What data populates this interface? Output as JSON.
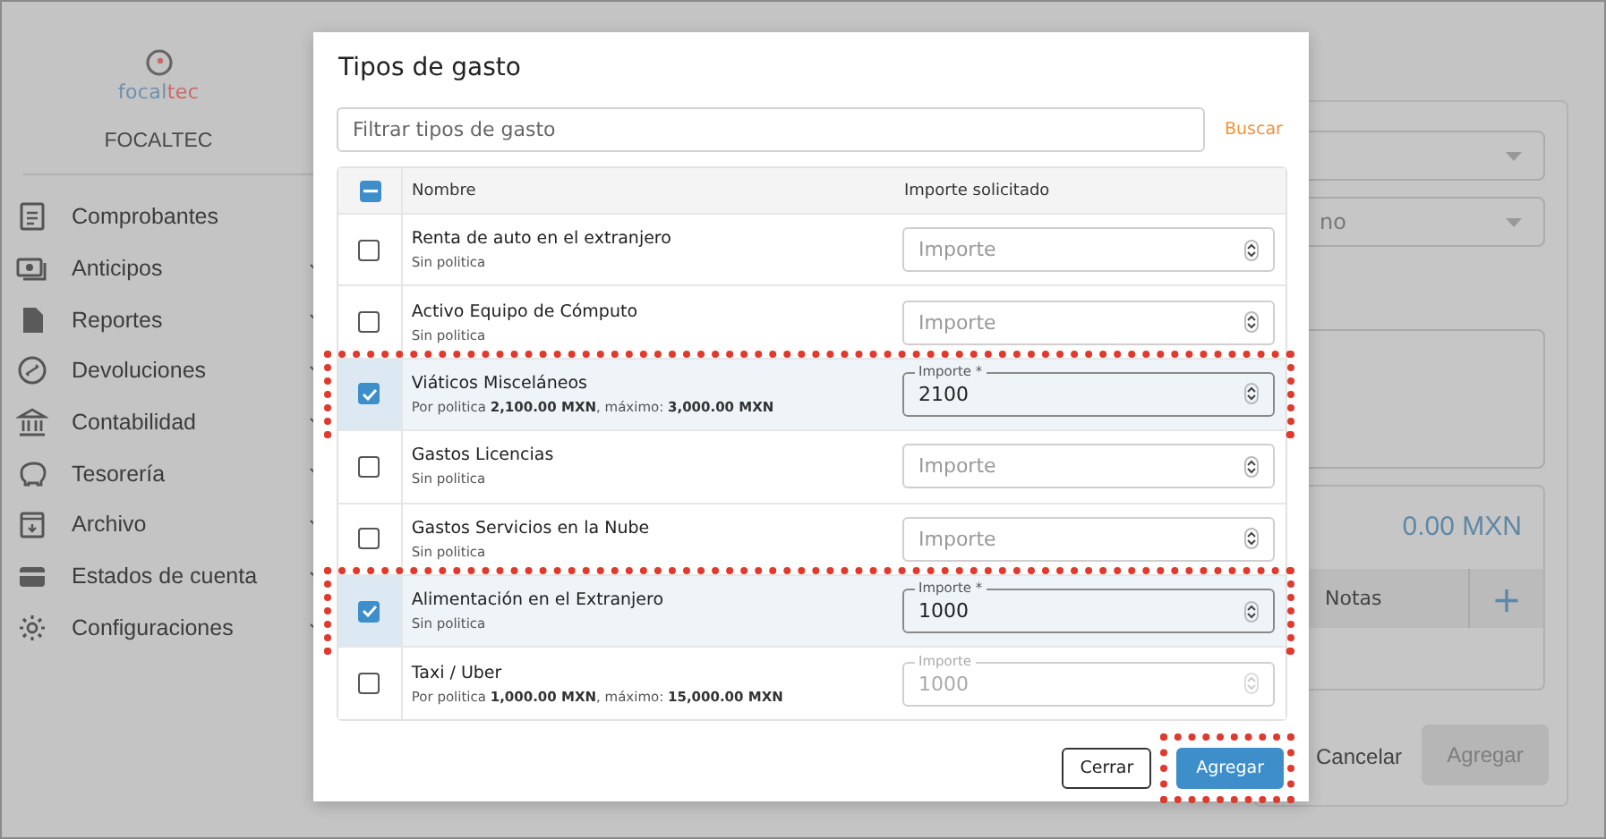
{
  "sidebar": {
    "logo": [
      {
        "text": "focal",
        "color": "#6f8fae"
      },
      {
        "text": "tec",
        "color": "#c86a6a"
      }
    ],
    "company": "FOCALTEC",
    "items": [
      {
        "label": "Comprobantes",
        "expandable": false
      },
      {
        "label": "Anticipos",
        "expandable": true
      },
      {
        "label": "Reportes",
        "expandable": true
      },
      {
        "label": "Devoluciones",
        "expandable": true
      },
      {
        "label": "Contabilidad",
        "expandable": true
      },
      {
        "label": "Tesorería",
        "expandable": true
      },
      {
        "label": "Archivo",
        "expandable": true
      },
      {
        "label": "Estados de cuenta",
        "expandable": true
      },
      {
        "label": "Configuraciones",
        "expandable": true
      }
    ]
  },
  "background_form": {
    "select_2_value": "no",
    "total": "0.00 MXN",
    "notes_header": "Notas",
    "add_symbol": "+",
    "cancel": "Cancelar",
    "submit": "Agregar"
  },
  "dialog": {
    "title": "Tipos de gasto",
    "filter": {
      "placeholder": "Filtrar tipos de gasto"
    },
    "search": "Buscar",
    "table": {
      "select_all": {
        "indeterminate": true
      },
      "columns": [
        "Nombre",
        "Importe solicitado"
      ],
      "rows": [
        {
          "name": "Renta de auto en el extranjero",
          "policy": "Sin politica",
          "checked": false,
          "highlighted": false,
          "amount": {
            "placeholder": "Importe"
          }
        },
        {
          "name": "Activo Equipo de Cómputo",
          "policy": "Sin politica",
          "checked": false,
          "highlighted": false,
          "amount": {
            "placeholder": "Importe"
          }
        },
        {
          "name": "Viáticos Misceláneos",
          "policy": "Por politica **2,100.00 MXN**, máximo: **3,000.00 MXN**",
          "checked": true,
          "highlighted": true,
          "amount": {
            "label": "Importe *",
            "value": "2100",
            "disabled": false
          }
        },
        {
          "name": "Gastos Licencias",
          "policy": "Sin politica",
          "checked": false,
          "highlighted": false,
          "amount": {
            "placeholder": "Importe"
          }
        },
        {
          "name": "Gastos Servicios en la Nube",
          "policy": "Sin politica",
          "checked": false,
          "highlighted": false,
          "amount": {
            "placeholder": "Importe"
          }
        },
        {
          "name": "Alimentación en el Extranjero",
          "policy": "Sin politica",
          "checked": true,
          "highlighted": true,
          "amount": {
            "label": "Importe *",
            "value": "1000",
            "disabled": false
          }
        },
        {
          "name": "Taxi / Uber",
          "policy": "Por politica **1,000.00 MXN**, máximo: **15,000.00 MXN**",
          "checked": false,
          "highlighted": false,
          "amount": {
            "label": "Importe",
            "value": "1000",
            "disabled": true
          }
        }
      ]
    },
    "buttons": [
      {
        "label": "Cerrar",
        "kind": "secondary",
        "highlighted": false
      },
      {
        "label": "Agregar",
        "kind": "primary",
        "highlighted": true
      }
    ]
  }
}
